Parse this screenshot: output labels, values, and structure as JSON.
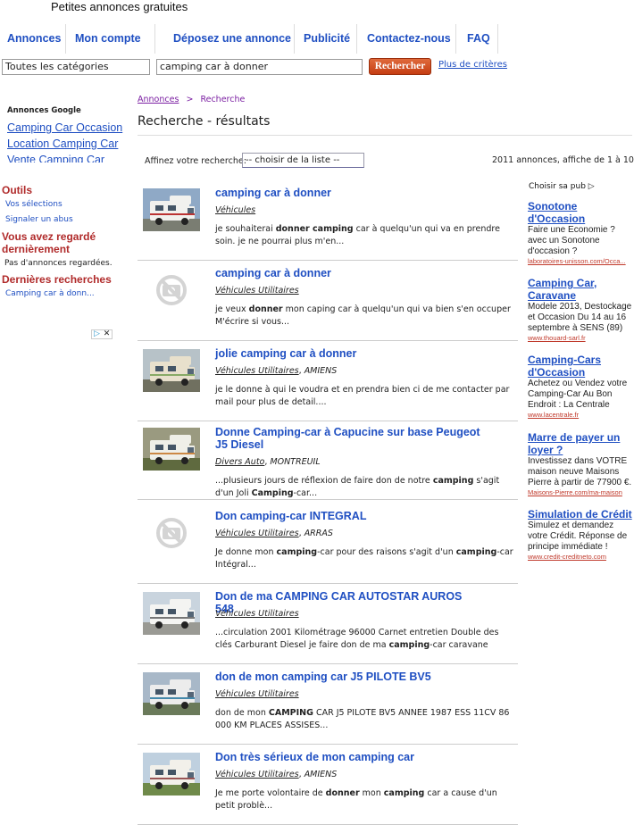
{
  "site": {
    "title": "Petites annonces gratuites"
  },
  "nav": [
    "Annonces",
    "Mon compte",
    "Déposez une annonce",
    "Publicité",
    "Contactez-nous",
    "FAQ"
  ],
  "search": {
    "category": "Toutes les catégories",
    "query": "camping car à donner",
    "button": "Rechercher",
    "more": "Plus de critères"
  },
  "left": {
    "ads_label": "Annonces Google",
    "ad_links": [
      "Camping Car Occasion",
      "Location Camping Car",
      "Vente Camping Car"
    ],
    "tools_heading": "Outils",
    "tools": [
      "Vos sélections",
      "Signaler un abus"
    ],
    "viewed_heading": "Vous avez regardé dernièrement",
    "viewed_text": "Pas d'annonces regardées.",
    "recent_heading": "Dernières recherches",
    "recent_link": "Camping car à donn..."
  },
  "breadcrumb": {
    "home": "Annonces",
    "sep": ">",
    "current": "Recherche"
  },
  "page_title": "Recherche - résultats",
  "refine": {
    "label": "Affinez votre recherche:",
    "select": "-- choisir de la liste --"
  },
  "count": "2011 annonces, affiche de 1 à 10",
  "results": [
    {
      "title": "camping car à donner",
      "category": "Véhicules",
      "city": "",
      "thumb": "photo-motorhome-white",
      "desc": [
        [
          "je souhaiterai ",
          false
        ],
        [
          "donner camping",
          true
        ],
        [
          " car à quelqu'un qui va en prendre soin. je ne pourrai plus m'en...",
          false
        ]
      ]
    },
    {
      "title": "camping car à donner",
      "category": "Véhicules Utilitaires",
      "city": "",
      "thumb": "no-photo-camera-icon",
      "desc": [
        [
          "je veux ",
          false
        ],
        [
          "donner",
          true
        ],
        [
          " mon caping car à quelqu'un qui va bien s'en occuper M'écrire si vous...",
          false
        ]
      ]
    },
    {
      "title": "jolie camping car à donner",
      "category": "Véhicules Utilitaires",
      "city": "AMIENS",
      "thumb": "photo-motorhome-beige",
      "desc": [
        [
          "je le donne à qui le voudra et en prendra bien ci de me contacter par mail pour plus de detail....",
          false
        ]
      ]
    },
    {
      "title": "Donne Camping-car à Capucine sur base Peugeot J5 Diesel",
      "category": "Divers Auto",
      "city": "MONTREUIL",
      "thumb": "photo-motorhome-capucine",
      "desc": [
        [
          "...plusieurs jours de réflexion de faire don de notre ",
          false
        ],
        [
          "camping",
          true
        ],
        [
          " s'agit d'un Joli ",
          false
        ],
        [
          "Camping",
          true
        ],
        [
          "-car...",
          false
        ]
      ]
    },
    {
      "title": "Don camping-car INTEGRAL",
      "category": "Véhicules Utilitaires",
      "city": "ARRAS",
      "thumb": "no-photo-camera-icon",
      "desc": [
        [
          "Je donne mon ",
          false
        ],
        [
          "camping",
          true
        ],
        [
          "-car pour des raisons s'agit d'un ",
          false
        ],
        [
          "camping",
          true
        ],
        [
          "-car Intégral...",
          false
        ]
      ]
    },
    {
      "title": "Don de ma CAMPING CAR AUTOSTAR AUROS 548",
      "category": "Véhicules Utilitaires",
      "city": "",
      "thumb": "photo-motorhome-autostar",
      "desc": [
        [
          "...circulation 2001 Kilométrage 96000 Carnet entretien Double des clés Carburant Diesel je faire don de ma ",
          false
        ],
        [
          "camping",
          true
        ],
        [
          "-car caravane",
          false
        ]
      ]
    },
    {
      "title": "don de mon camping car J5 PILOTE BV5",
      "category": "Véhicules Utilitaires",
      "city": "",
      "thumb": "photo-motorhome-pilote",
      "desc": [
        [
          "don de mon ",
          false
        ],
        [
          "CAMPING",
          true
        ],
        [
          " CAR J5 PILOTE BV5 ANNEE 1987 ESS 11CV 86 000 KM PLACES ASSISES...",
          false
        ]
      ]
    },
    {
      "title": "Don très sérieux de mon camping car",
      "category": "Véhicules Utilitaires",
      "city": "AMIENS",
      "thumb": "photo-motorhome-field",
      "desc": [
        [
          "Je me porte volontaire de ",
          false
        ],
        [
          "donner",
          true
        ],
        [
          " mon ",
          false
        ],
        [
          "camping",
          true
        ],
        [
          " car a cause d'un petit problè...",
          false
        ]
      ]
    }
  ],
  "right_ads": {
    "choisir": "Choisir sa pub ▷",
    "ads": [
      {
        "title": "Sonotone d'Occasion",
        "body": "Faire une Economie ? avec un Sonotone d'occasion ?",
        "url": "laboratoires-unisson.com/Occa..."
      },
      {
        "title": "Camping Car, Caravane",
        "body": "Modele 2013, Destockage et Occasion Du 14 au 16 septembre à SENS (89)",
        "url": "www.thouard-sarl.fr"
      },
      {
        "title": "Camping-Cars d'Occasion",
        "body": "Achetez ou Vendez votre Camping-Car Au Bon Endroit : La Centrale",
        "url": "www.lacentrale.fr"
      },
      {
        "title": "Marre de payer un loyer ?",
        "body": "Investissez dans VOTRE maison neuve Maisons Pierre à partir de 77900 €.",
        "url": "Maisons-Pierre.com/ma-maison"
      },
      {
        "title": "Simulation de Crédit",
        "body": "Simulez et demandez votre Crédit. Réponse de principe immédiate !",
        "url": "www.credit-creditneto.com"
      }
    ]
  }
}
